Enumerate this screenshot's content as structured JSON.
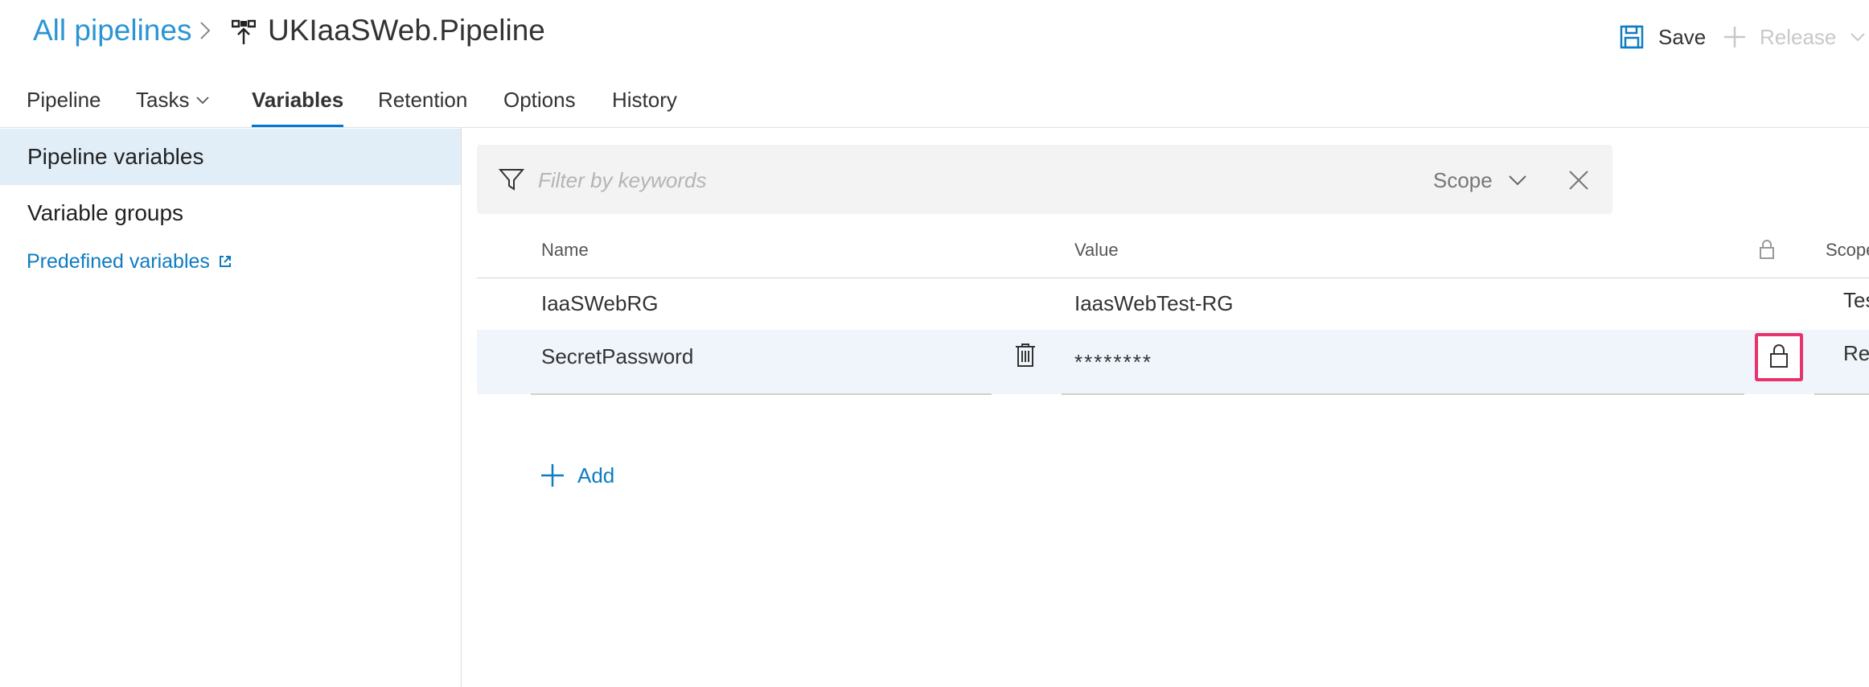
{
  "header": {
    "breadcrumb_link": "All pipelines",
    "pipeline_title": "UKIaaSWeb.Pipeline",
    "save_label": "Save",
    "release_label": "Release"
  },
  "tabs": [
    {
      "label": "Pipeline",
      "active": false
    },
    {
      "label": "Tasks",
      "active": false
    },
    {
      "label": "Variables",
      "active": true
    },
    {
      "label": "Retention",
      "active": false
    },
    {
      "label": "Options",
      "active": false
    },
    {
      "label": "History",
      "active": false
    }
  ],
  "sidebar": {
    "items": [
      {
        "label": "Pipeline variables",
        "selected": true
      },
      {
        "label": "Variable groups",
        "selected": false
      }
    ],
    "link_label": "Predefined variables"
  },
  "filter": {
    "placeholder": "Filter by keywords",
    "value": "",
    "scope_label": "Scope"
  },
  "table": {
    "columns": {
      "name": "Name",
      "value": "Value",
      "scope": "Scope"
    },
    "rows": [
      {
        "name": "IaaSWebRG",
        "value": "IaasWebTest-RG",
        "scope": "Test",
        "secret": false
      },
      {
        "name": "SecretPassword",
        "value": "********",
        "scope": "Release",
        "secret": true
      }
    ]
  },
  "add_label": "Add",
  "colors": {
    "accent": "#0078d4",
    "link": "#2b95d4",
    "highlight": "#e8326b",
    "selected_bg": "#e1eef8",
    "row_hover_bg": "#eff5fb"
  }
}
